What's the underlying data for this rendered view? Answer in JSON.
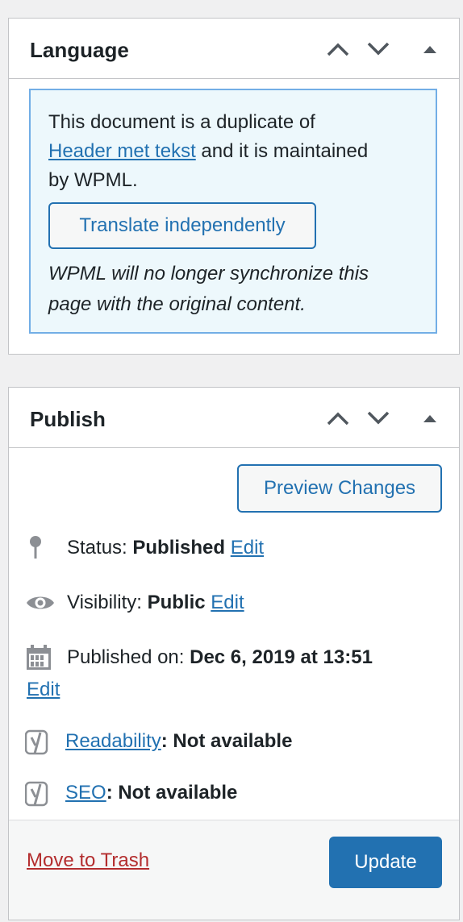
{
  "language": {
    "title": "Language",
    "notice": {
      "line1": "This document is a duplicate of",
      "link": "Header met tekst",
      "line2_rest": " and it is maintained",
      "line3": "by WPML.",
      "button": "Translate independently",
      "italic_line1": "WPML will no longer synchronize this",
      "italic_line2": "page with the original content."
    }
  },
  "publish": {
    "title": "Publish",
    "preview_button": "Preview Changes",
    "status_label": "Status: ",
    "status_value": "Published",
    "visibility_label": "Visibility: ",
    "visibility_value": "Public",
    "published_label": "Published on: ",
    "published_value": "Dec 6, 2019 at 13:51",
    "edit": "Edit",
    "readability_link": "Readability",
    "readability_value": ": Not available",
    "seo_link": "SEO",
    "seo_value": ": Not available",
    "trash": "Move to Trash",
    "update": "Update"
  },
  "icons": {
    "move_up": "chevron-up-icon",
    "move_down": "chevron-down-icon",
    "toggle": "triangle-up-icon",
    "status": "pin-icon",
    "visibility": "eye-icon",
    "published": "calendar-icon",
    "readability": "yoast-icon",
    "seo": "yoast-icon"
  },
  "colors": {
    "link": "#2271b1",
    "danger": "#b32d2e",
    "primary": "#2271b1",
    "notice_bg": "#edf8fc",
    "notice_border": "#72aee6"
  }
}
